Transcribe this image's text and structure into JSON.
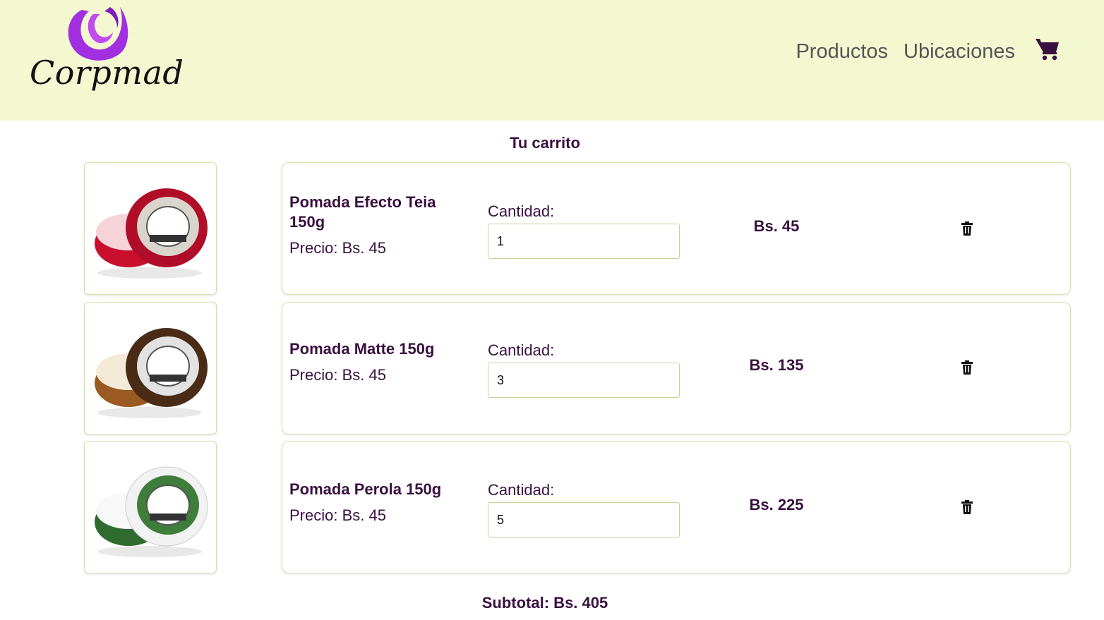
{
  "header": {
    "brand": "Corpmad",
    "nav": [
      {
        "label": "Productos"
      },
      {
        "label": "Ubicaciones"
      }
    ],
    "cart_icon": "shopping-cart-icon",
    "accent_color": "#9b2fd8",
    "background_color": "#f3f8d1"
  },
  "main": {
    "title": "Tu carrito",
    "items": [
      {
        "name": "Pomada Efecto Teia 150g",
        "price": "Precio: Bs. 45",
        "qty_label": "Cantidad:",
        "qty": "1",
        "total": "Bs. 45",
        "jar_color": "#c8102e"
      },
      {
        "name": "Pomada Matte 150g",
        "price": "Precio: Bs. 45",
        "qty_label": "Cantidad:",
        "qty": "3",
        "total": "Bs. 135",
        "jar_color": "#5a3418"
      },
      {
        "name": "Pomada Perola 150g",
        "price": "Precio: Bs. 45",
        "qty_label": "Cantidad:",
        "qty": "5",
        "total": "Bs. 225",
        "jar_color": "#2f6b2f"
      }
    ],
    "subtotal": "Subtotal: Bs. 405"
  }
}
